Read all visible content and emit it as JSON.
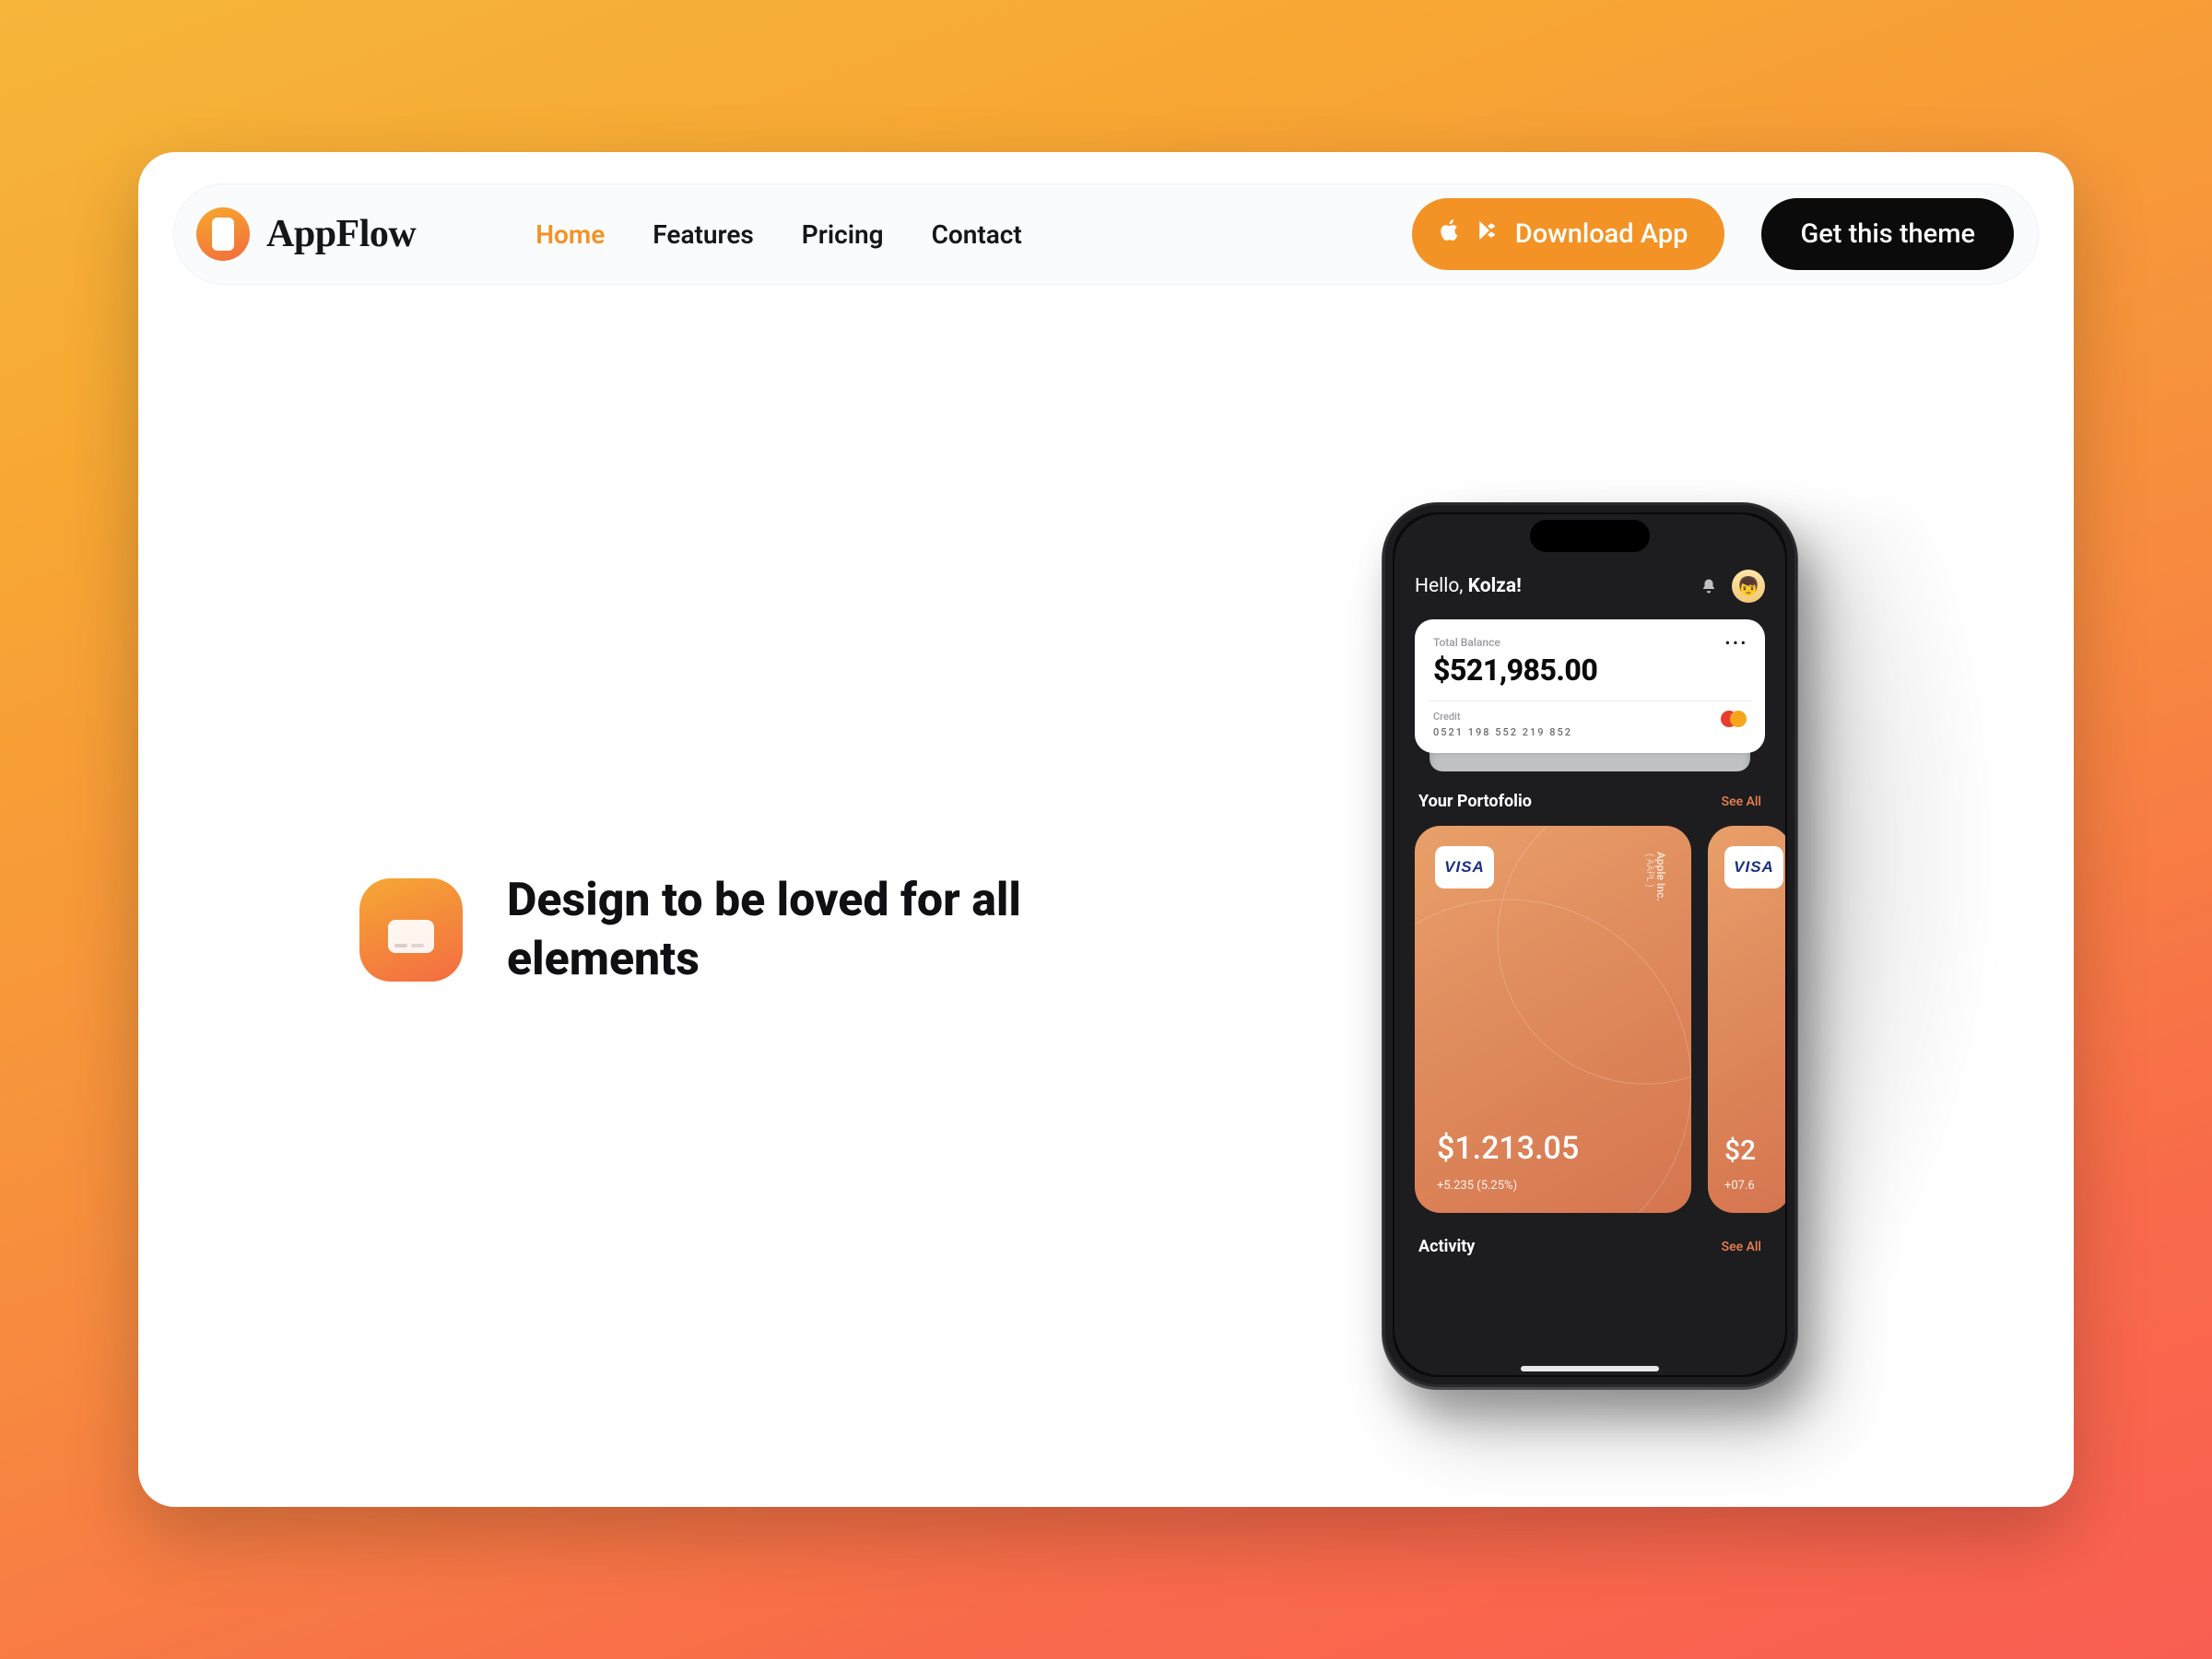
{
  "brand": {
    "name": "AppFlow"
  },
  "nav": {
    "links": [
      {
        "label": "Home",
        "active": true
      },
      {
        "label": "Features",
        "active": false
      },
      {
        "label": "Pricing",
        "active": false
      },
      {
        "label": "Contact",
        "active": false
      }
    ]
  },
  "buttons": {
    "download": "Download App",
    "theme": "Get this theme"
  },
  "hero": {
    "headline": "Design to be loved for all elements"
  },
  "app": {
    "greeting_prefix": "Hello, ",
    "greeting_name": "Kolza!",
    "balance": {
      "label": "Total Balance",
      "amount": "$521,985.00",
      "credit_label": "Credit",
      "card_number": "0521  198  552  219  852"
    },
    "portfolio": {
      "title": "Your Portofolio",
      "see_all": "See All",
      "cards": [
        {
          "brand": "VISA",
          "company": "Apple Inc.",
          "symbol": "( AAPL )",
          "amount": "$1.213.05",
          "change": "+5.235 (5.25%)"
        },
        {
          "brand": "VISA",
          "amount": "$2",
          "change": "+07.6"
        }
      ]
    },
    "activity": {
      "title": "Activity",
      "see_all": "See All"
    }
  }
}
